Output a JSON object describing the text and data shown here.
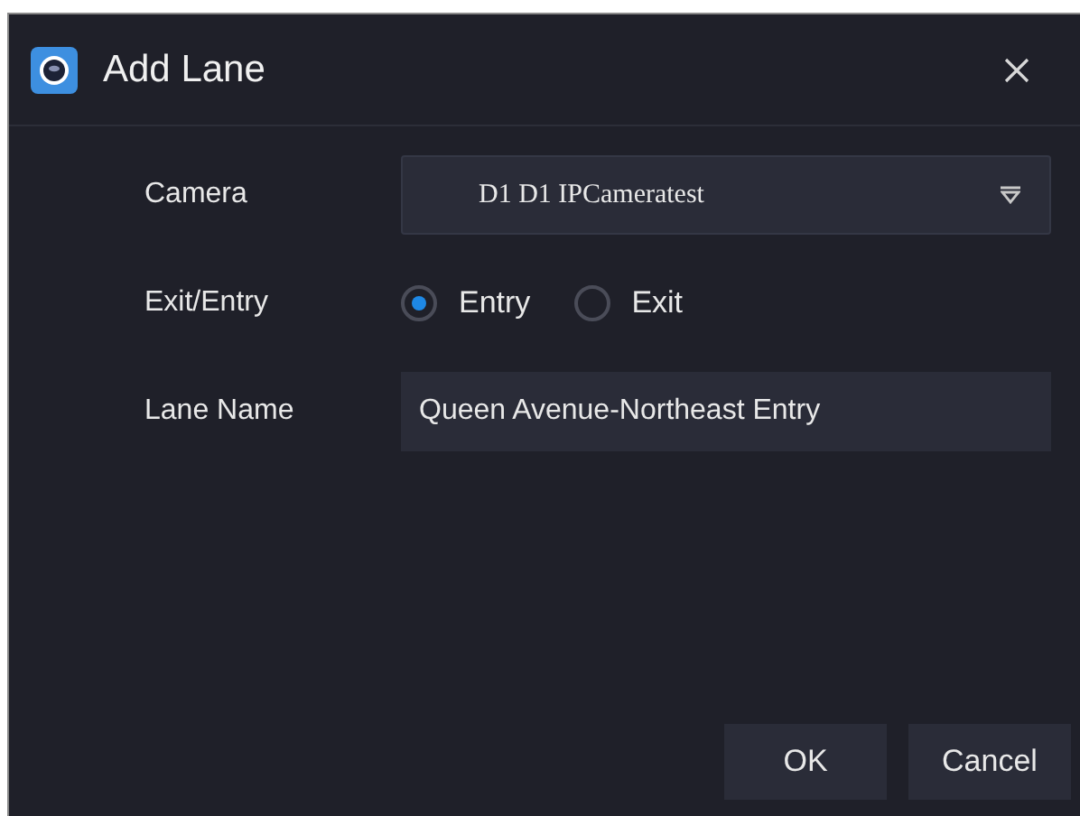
{
  "window": {
    "title": "Add Lane"
  },
  "form": {
    "camera": {
      "label": "Camera",
      "value": "D1 D1 IPCameratest"
    },
    "direction": {
      "label": "Exit/Entry",
      "options": [
        {
          "label": "Entry",
          "selected": true
        },
        {
          "label": "Exit",
          "selected": false
        }
      ]
    },
    "lane_name": {
      "label": "Lane Name",
      "value": "Queen Avenue-Northeast Entry"
    }
  },
  "buttons": [
    "OK",
    "Cancel"
  ]
}
